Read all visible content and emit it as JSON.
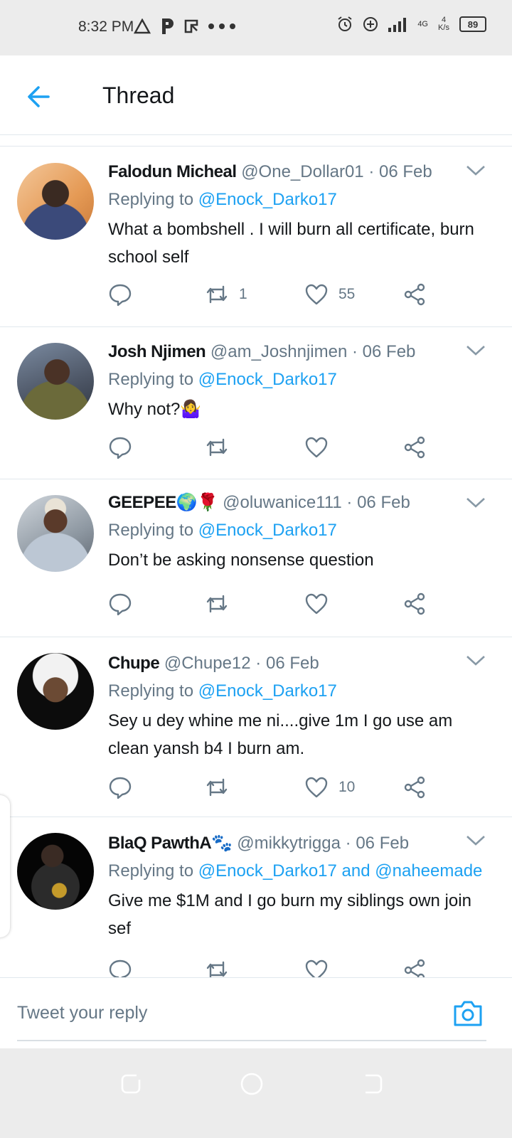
{
  "status_bar": {
    "time": "8:32 PM",
    "network": "4G",
    "speed": "4 K/s",
    "battery": "89"
  },
  "header": {
    "title": "Thread",
    "back_icon": "arrow-left-icon"
  },
  "colors": {
    "accent": "#1da1f2",
    "text": "#14171a",
    "muted": "#657786",
    "divider": "#e1e8ed"
  },
  "tweets": [
    {
      "name": "Falodun Micheal",
      "handle": "@One_Dollar01",
      "sep": "·",
      "date": "06 Feb",
      "replying_prefix": "Replying to",
      "replying_to": "@Enock_Darko17",
      "text": "What a bombshell . I will burn all certificate, burn school self",
      "retweets": "1",
      "likes": "55"
    },
    {
      "name": "Josh Njimen",
      "handle": "@am_Joshnjimen",
      "sep": "·",
      "date": "06 Feb",
      "replying_prefix": "Replying to",
      "replying_to": "@Enock_Darko17",
      "text": "Why not?🤷‍♀️",
      "retweets": "",
      "likes": ""
    },
    {
      "name": "GEEPEE🌍🌹",
      "handle": "@oluwanice111",
      "sep": "·",
      "date": "06 Feb",
      "replying_prefix": "Replying to",
      "replying_to": "@Enock_Darko17",
      "text": "Don’t be asking nonsense question",
      "retweets": "",
      "likes": ""
    },
    {
      "name": "Chupe",
      "handle": "@Chupe12",
      "sep": "·",
      "date": "06 Feb",
      "replying_prefix": "Replying to",
      "replying_to": "@Enock_Darko17",
      "text": "Sey u dey whine me ni....give 1m I go use am clean yansh b4 I burn am.",
      "retweets": "",
      "likes": "10"
    },
    {
      "name": "BlaQ PawthA🐾",
      "handle": "@mikkytrigga",
      "sep": "·",
      "date": "06 Feb",
      "replying_prefix": "Replying to",
      "replying_to": "@Enock_Darko17 and @naheemade",
      "text": "Give me $1M and I go burn my siblings own join sef",
      "retweets": "",
      "likes": ""
    }
  ],
  "reply_bar": {
    "placeholder": "Tweet your reply",
    "camera_icon": "camera-icon"
  },
  "nav": {
    "icons": [
      "recent-apps-icon",
      "home-icon",
      "back-icon"
    ]
  }
}
